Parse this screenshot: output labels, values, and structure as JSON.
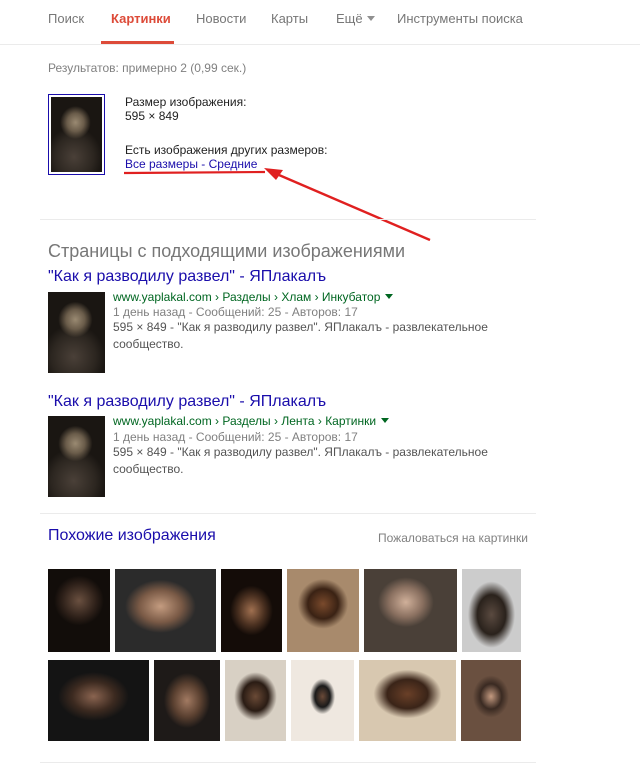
{
  "nav": {
    "tabs": [
      "Поиск",
      "Картинки",
      "Новости",
      "Карты",
      "Ещё",
      "Инструменты поиска"
    ]
  },
  "stats": "Результатов: примерно 2 (0,99 сек.)",
  "image_info": {
    "size_label": "Размер изображения:",
    "size_value": "595 × 849",
    "other_sizes_label": "Есть изображения других размеров:",
    "all_sizes": "Все размеры",
    "separator": " - ",
    "medium": "Средние"
  },
  "matching_pages": {
    "title": "Страницы с подходящими изображениями",
    "results": [
      {
        "title": "\"Как я разводилу развел\" - ЯПлакалъ",
        "url": "www.yaplakal.com › Разделы › Хлам › Инкубатор",
        "meta": "1 день назад - Сообщений: 25 - Авторов: 17",
        "snippet": "595 × 849 - \"Как я разводилу развел\". ЯПлакалъ - развлекательное сообщество."
      },
      {
        "title": "\"Как я разводилу развел\" - ЯПлакалъ",
        "url": "www.yaplakal.com › Разделы › Лента › Картинки",
        "meta": "1 день назад - Сообщений: 25 - Авторов: 17",
        "snippet": "595 × 849 - \"Как я разводилу развел\". ЯПлакалъ - развлекательное сообщество."
      }
    ]
  },
  "similar": {
    "title": "Похожие изображения",
    "report": "Пожаловаться на картинки"
  },
  "colors": {
    "accent": "#dd4b39",
    "link": "#1a0dab",
    "url_green": "#006621",
    "annotation_red": "#e02020"
  }
}
